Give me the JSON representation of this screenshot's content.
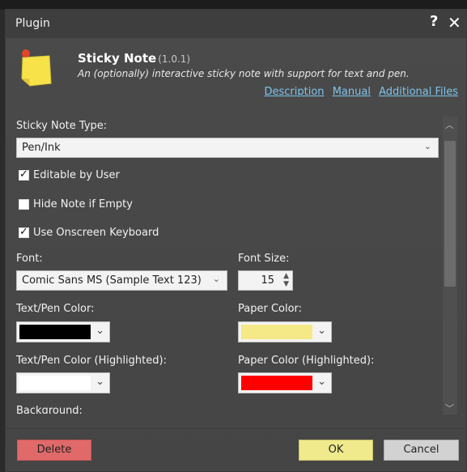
{
  "dialog": {
    "title": "Plugin",
    "help_label": "?",
    "close_label": "✕"
  },
  "plugin": {
    "name": "Sticky Note",
    "version": "(1.0.1)",
    "description": "An (optionally) interactive sticky note with support for text and pen.",
    "links": [
      "Description",
      "Manual",
      "Additional Files"
    ]
  },
  "form": {
    "type_label": "Sticky Note Type:",
    "type_value": "Pen/Ink",
    "editable_label": "Editable by User",
    "editable_checked": true,
    "hide_label": "Hide Note if Empty",
    "hide_checked": false,
    "keyboard_label": "Use Onscreen Keyboard",
    "keyboard_checked": true,
    "font_label": "Font:",
    "font_value": "Comic Sans MS (Sample Text 123)",
    "font_size_label": "Font Size:",
    "font_size_value": "15",
    "text_color_label": "Text/Pen Color:",
    "text_color": "#000000",
    "paper_color_label": "Paper Color:",
    "paper_color": "#f5e887",
    "text_color_hl_label": "Text/Pen Color (Highlighted):",
    "text_color_hl": "#ffffff",
    "paper_color_hl_label": "Paper Color (Highlighted):",
    "paper_color_hl": "#ff0000",
    "background_label": "Background:"
  },
  "buttons": {
    "delete": "Delete",
    "ok": "OK",
    "cancel": "Cancel"
  },
  "icons": [
    "sticky-note-icon",
    "help-icon",
    "close-icon",
    "chevron-down-icon",
    "checkbox-check-icon",
    "scroll-up-icon",
    "scroll-down-icon"
  ],
  "colors": {
    "accent_link": "#7ec3ea",
    "delete": "#e06a6a",
    "ok": "#f0ea8c",
    "cancel": "#d2d2d2"
  }
}
